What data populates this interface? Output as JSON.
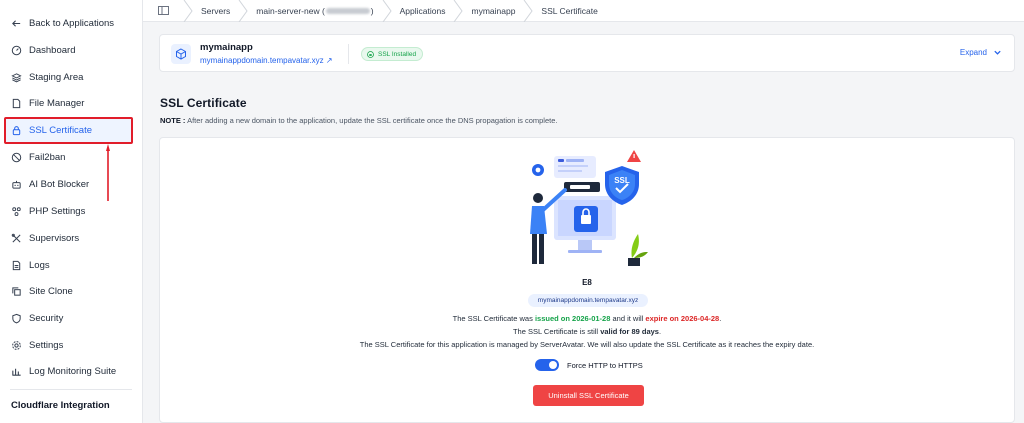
{
  "sidebar": {
    "back_label": "Back to Applications",
    "items": [
      {
        "label": "Dashboard",
        "icon": "dashboard-icon"
      },
      {
        "label": "Staging Area",
        "icon": "layers-icon"
      },
      {
        "label": "File Manager",
        "icon": "file-icon"
      },
      {
        "label": "SSL Certificate",
        "icon": "lock-icon",
        "active": true
      },
      {
        "label": "Fail2ban",
        "icon": "ban-icon"
      },
      {
        "label": "AI Bot Blocker",
        "icon": "robot-icon"
      },
      {
        "label": "PHP Settings",
        "icon": "nodes-icon"
      },
      {
        "label": "Supervisors",
        "icon": "tools-icon"
      },
      {
        "label": "Logs",
        "icon": "document-icon"
      },
      {
        "label": "Site Clone",
        "icon": "copy-icon"
      },
      {
        "label": "Security",
        "icon": "shield-icon"
      },
      {
        "label": "Settings",
        "icon": "gear-icon"
      },
      {
        "label": "Log Monitoring Suite",
        "icon": "chart-icon"
      }
    ],
    "section_label": "Cloudflare Integration"
  },
  "breadcrumb": {
    "servers": "Servers",
    "server_prefix": "main-server-new (",
    "server_suffix": ")",
    "applications": "Applications",
    "app": "mymainapp",
    "current": "SSL Certificate"
  },
  "app_header": {
    "name": "mymainapp",
    "domain": "mymainappdomain.tempavatar.xyz ↗",
    "ssl_badge": "SSL Installed",
    "expand_label": "Expand"
  },
  "page": {
    "title": "SSL Certificate",
    "note_label": "NOTE :",
    "note_text": " After adding a new domain to the application, update the SSL certificate once the DNS propagation is complete."
  },
  "certificate": {
    "name": "E8",
    "domain": "mymainappdomain.tempavatar.xyz",
    "line1_a": "The SSL Certificate was ",
    "issued": "issued on 2026-01-28",
    "line1_b": " and it will ",
    "expire": "expire on 2026-04-28",
    "line1_c": ".",
    "line2_a": "The SSL Certificate is still ",
    "valid": "valid for 89 days",
    "line2_b": ".",
    "line3": "The SSL Certificate for this application is managed by ServerAvatar. We will also update the SSL Certificate as it reaches the expiry date.",
    "toggle_label": "Force HTTP to HTTPS",
    "toggle_on": true,
    "uninstall_label": "Uninstall SSL Certificate"
  },
  "colors": {
    "accent": "#2563eb",
    "success": "#16a34a",
    "danger": "#dc2626",
    "button_danger": "#ef4444",
    "annotation": "#e11d2a"
  }
}
